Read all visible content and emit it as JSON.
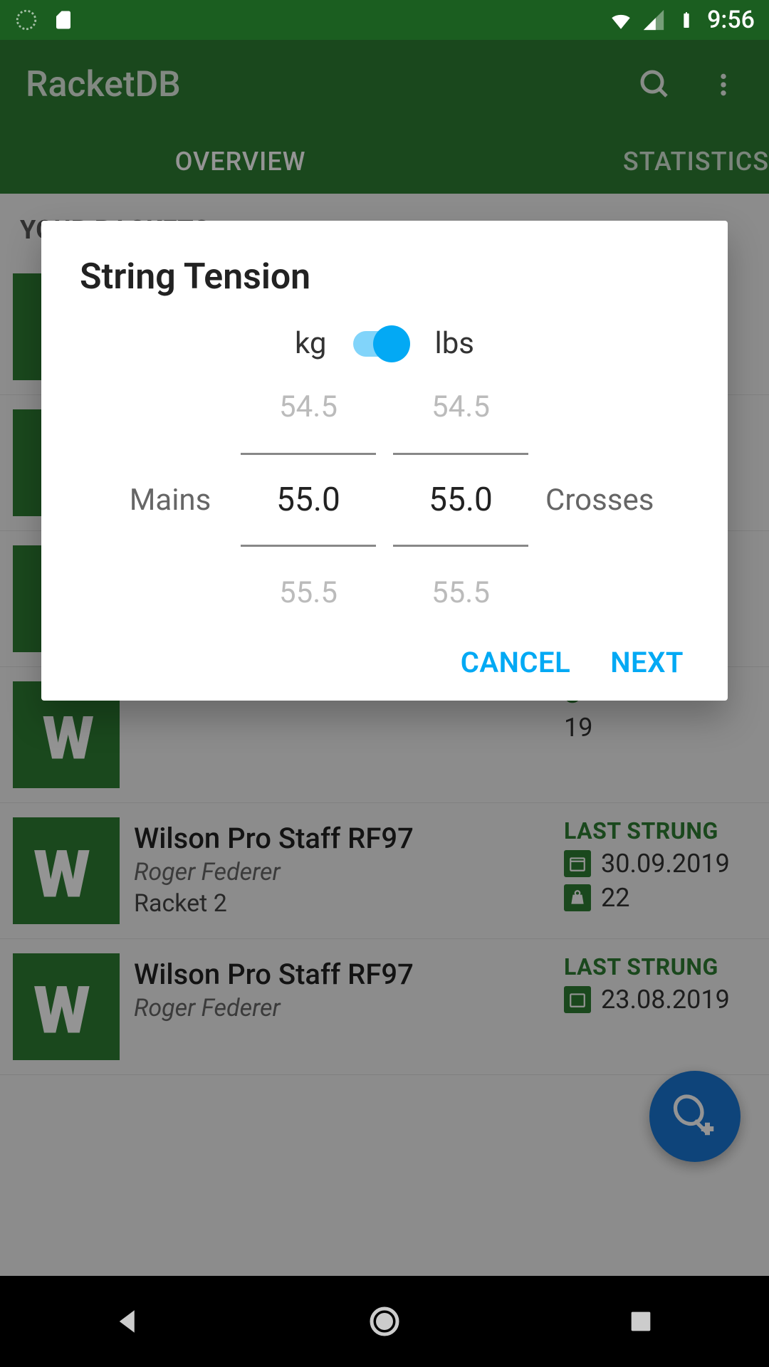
{
  "status": {
    "time": "9:56"
  },
  "app": {
    "title": "RacketDB"
  },
  "tabs": {
    "overview": "OVERVIEW",
    "statistics": "STATISTICS"
  },
  "section_title": "YOUR RACKETS",
  "meta_label": "LAST STRUNG",
  "rackets": [
    {
      "name": "Wilson Pro Staff RF97",
      "player": "Roger Federer",
      "num": "Racket 2",
      "date": "30.09.2019",
      "tension": "22"
    },
    {
      "name": "Wilson Pro Staff RF97",
      "player": "Roger Federer",
      "num": "",
      "date": "23.08.2019",
      "tension": ""
    }
  ],
  "dialog": {
    "title": "String Tension",
    "unit_left": "kg",
    "unit_right": "lbs",
    "mains_label": "Mains",
    "crosses_label": "Crosses",
    "mains": {
      "prev": "54.5",
      "cur": "55.0",
      "next": "55.5"
    },
    "crosses": {
      "prev": "54.5",
      "cur": "55.0",
      "next": "55.5"
    },
    "cancel": "CANCEL",
    "next": "NEXT"
  }
}
